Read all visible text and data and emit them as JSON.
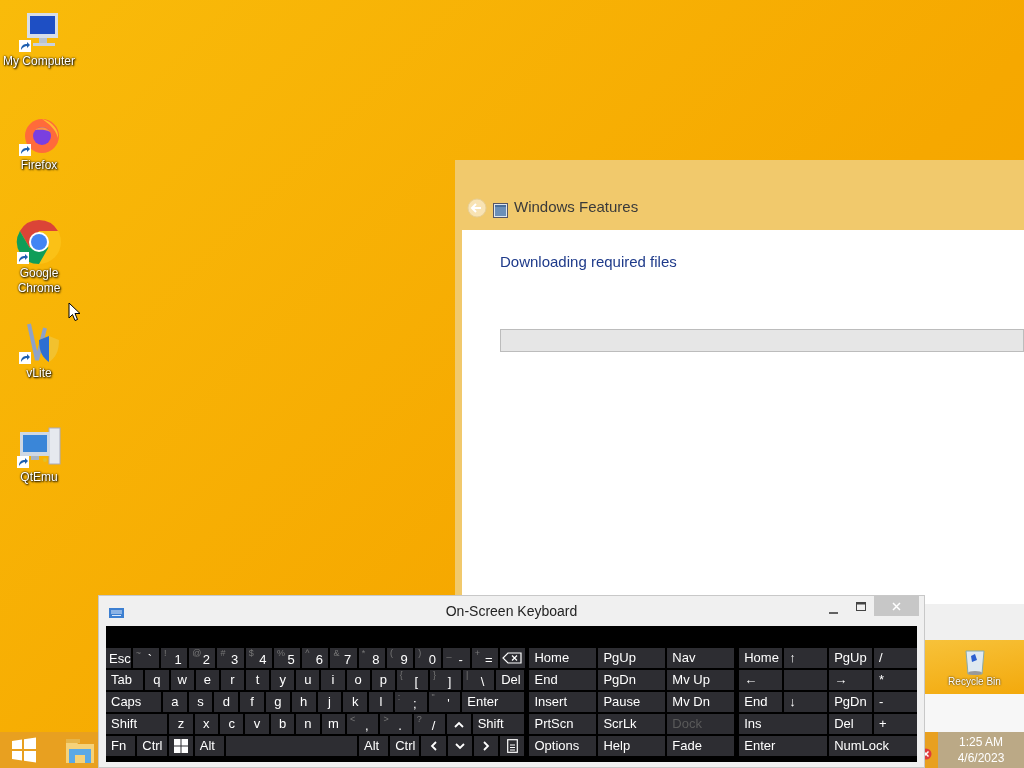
{
  "desktop_icons": [
    {
      "label": "My Computer",
      "kind": "computer"
    },
    {
      "label": "Firefox",
      "kind": "firefox"
    },
    {
      "label": "Google Chrome",
      "kind": "chrome"
    },
    {
      "label": "vLite",
      "kind": "vlite"
    },
    {
      "label": "QtEmu",
      "kind": "qtemu"
    }
  ],
  "windows_features": {
    "title": "Windows Features",
    "heading": "Downloading required files",
    "progress": {
      "level": 0
    }
  },
  "recycle_bin": {
    "label": "Recycle Bin"
  },
  "on_screen_keyboard": {
    "title": "On-Screen Keyboard",
    "main_rows": [
      [
        {
          "kind": "label",
          "label": "Esc"
        },
        {
          "kind": "char",
          "label": "`",
          "shift": "~"
        },
        {
          "kind": "char",
          "label": "1",
          "shift": "!"
        },
        {
          "kind": "char",
          "label": "2",
          "shift": "@"
        },
        {
          "kind": "char",
          "label": "3",
          "shift": "#"
        },
        {
          "kind": "char",
          "label": "4",
          "shift": "$"
        },
        {
          "kind": "char",
          "label": "5",
          "shift": "%"
        },
        {
          "kind": "char",
          "label": "6",
          "shift": "^"
        },
        {
          "kind": "char",
          "label": "7",
          "shift": "&"
        },
        {
          "kind": "char",
          "label": "8",
          "shift": "*"
        },
        {
          "kind": "char",
          "label": "9",
          "shift": "("
        },
        {
          "kind": "char",
          "label": "0",
          "shift": ")"
        },
        {
          "kind": "char",
          "label": "-",
          "shift": "_"
        },
        {
          "kind": "char",
          "label": "=",
          "shift": "+"
        },
        {
          "kind": "backspace"
        }
      ],
      [
        {
          "kind": "label",
          "label": "Tab"
        },
        {
          "kind": "char",
          "label": "q"
        },
        {
          "kind": "char",
          "label": "w"
        },
        {
          "kind": "char",
          "label": "e"
        },
        {
          "kind": "char",
          "label": "r"
        },
        {
          "kind": "char",
          "label": "t"
        },
        {
          "kind": "char",
          "label": "y"
        },
        {
          "kind": "char",
          "label": "u"
        },
        {
          "kind": "char",
          "label": "i"
        },
        {
          "kind": "char",
          "label": "o"
        },
        {
          "kind": "char",
          "label": "p"
        },
        {
          "kind": "char",
          "label": "[",
          "shift": "{"
        },
        {
          "kind": "char",
          "label": "]",
          "shift": "}"
        },
        {
          "kind": "char",
          "label": "\\",
          "shift": "|"
        },
        {
          "kind": "label",
          "label": "Del"
        }
      ],
      [
        {
          "kind": "label",
          "label": "Caps"
        },
        {
          "kind": "char",
          "label": "a"
        },
        {
          "kind": "char",
          "label": "s"
        },
        {
          "kind": "char",
          "label": "d"
        },
        {
          "kind": "char",
          "label": "f"
        },
        {
          "kind": "char",
          "label": "g"
        },
        {
          "kind": "char",
          "label": "h"
        },
        {
          "kind": "char",
          "label": "j"
        },
        {
          "kind": "char",
          "label": "k"
        },
        {
          "kind": "char",
          "label": "l"
        },
        {
          "kind": "char",
          "label": ";",
          "shift": ":"
        },
        {
          "kind": "char",
          "label": "'",
          "shift": "\""
        },
        {
          "kind": "label",
          "label": "Enter"
        }
      ],
      [
        {
          "kind": "label",
          "label": "Shift"
        },
        {
          "kind": "char",
          "label": "z"
        },
        {
          "kind": "char",
          "label": "x"
        },
        {
          "kind": "char",
          "label": "c"
        },
        {
          "kind": "char",
          "label": "v"
        },
        {
          "kind": "char",
          "label": "b"
        },
        {
          "kind": "char",
          "label": "n"
        },
        {
          "kind": "char",
          "label": "m"
        },
        {
          "kind": "char",
          "label": ",",
          "shift": "<"
        },
        {
          "kind": "char",
          "label": ".",
          "shift": ">"
        },
        {
          "kind": "char",
          "label": "/",
          "shift": "?"
        },
        {
          "kind": "up"
        },
        {
          "kind": "label",
          "label": "Shift"
        }
      ],
      [
        {
          "kind": "label",
          "label": "Fn"
        },
        {
          "kind": "label",
          "label": "Ctrl"
        },
        {
          "kind": "windows"
        },
        {
          "kind": "label",
          "label": "Alt"
        },
        {
          "kind": "space"
        },
        {
          "kind": "label",
          "label": "Alt"
        },
        {
          "kind": "label",
          "label": "Ctrl"
        },
        {
          "kind": "left"
        },
        {
          "kind": "down"
        },
        {
          "kind": "right"
        },
        {
          "kind": "menu"
        }
      ]
    ],
    "nav_rows": [
      [
        {
          "label": "Home",
          "disabled": false
        },
        {
          "label": "PgUp",
          "disabled": false
        },
        {
          "label": "Nav",
          "disabled": false
        }
      ],
      [
        {
          "label": "End",
          "disabled": false
        },
        {
          "label": "PgDn",
          "disabled": false
        },
        {
          "label": "Mv Up",
          "disabled": false
        }
      ],
      [
        {
          "label": "Insert",
          "disabled": false
        },
        {
          "label": "Pause",
          "disabled": false
        },
        {
          "label": "Mv Dn",
          "disabled": false
        }
      ],
      [
        {
          "label": "PrtScn",
          "disabled": false
        },
        {
          "label": "ScrLk",
          "disabled": false
        },
        {
          "label": "Dock",
          "disabled": true
        }
      ],
      [
        {
          "label": "Options",
          "disabled": false
        },
        {
          "label": "Help",
          "disabled": false
        },
        {
          "label": "Fade",
          "disabled": false
        }
      ]
    ],
    "numpad_rows": [
      [
        {
          "label": "Home"
        },
        {
          "label": "↑"
        },
        {
          "label": "PgUp"
        },
        {
          "label": "/"
        }
      ],
      [
        {
          "label": "←"
        },
        {},
        {
          "label": "→"
        },
        {
          "label": "*"
        }
      ],
      [
        {
          "label": "End"
        },
        {
          "label": "↓"
        },
        {
          "label": "PgDn"
        },
        {
          "label": "-"
        }
      ],
      [
        {
          "label": "Ins"
        },
        {
          "label": "Del"
        },
        {
          "label": "+"
        }
      ],
      [
        {
          "label": "Enter"
        },
        {
          "label": "NumLock"
        }
      ]
    ]
  },
  "taskbar": {
    "time": "1:25 AM",
    "date": "4/6/2023"
  }
}
